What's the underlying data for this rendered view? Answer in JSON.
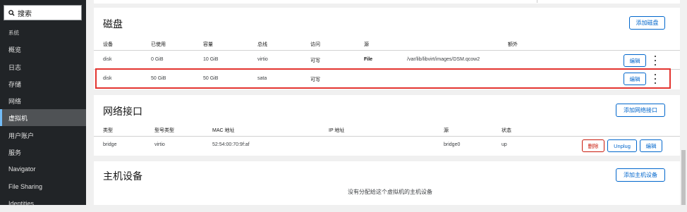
{
  "sidebar": {
    "search_placeholder": "搜索",
    "group_label": "系统",
    "items": [
      {
        "label": "概览"
      },
      {
        "label": "日志"
      },
      {
        "label": "存储"
      },
      {
        "label": "网络"
      },
      {
        "label": "虚拟机"
      },
      {
        "label": "用户账户"
      },
      {
        "label": "服务"
      },
      {
        "label": "Navigator"
      },
      {
        "label": "File Sharing"
      },
      {
        "label": "Identities"
      }
    ],
    "active_item": "虚拟机"
  },
  "disks": {
    "title": "磁盘",
    "add_button": "添加磁盘",
    "columns": [
      "设备",
      "已使用",
      "容量",
      "总线",
      "访问",
      "源",
      "额外"
    ],
    "rows": [
      {
        "device": "disk",
        "used": "0 GiB",
        "capacity": "10 GiB",
        "bus": "virtio",
        "access": "可写",
        "source_type": "File",
        "source_path": "/var/lib/libvirt/images/DSM.qcow2",
        "edit": "编辑"
      },
      {
        "device": "disk",
        "used": "50 GiB",
        "capacity": "50 GiB",
        "bus": "sata",
        "access": "可写",
        "source_type": "",
        "source_path": "",
        "edit": "编辑"
      }
    ]
  },
  "network": {
    "title": "网络接口",
    "add_button": "添加网络接口",
    "columns": [
      "类型",
      "型号类型",
      "MAC 地址",
      "IP 地址",
      "源",
      "状态"
    ],
    "rows": [
      {
        "type": "bridge",
        "model": "virtio",
        "mac": "52:54:00:70:9f:af",
        "ip": "",
        "source": "bridge0",
        "state": "up",
        "delete": "删除",
        "unplug": "Unplug",
        "edit": "编辑"
      }
    ]
  },
  "host_devices": {
    "title": "主机设备",
    "add_button": "添加主机设备",
    "empty_message": "没有分配给这个虚拟机的主机设备"
  },
  "colors": {
    "accent": "#0066cc",
    "danger": "#c9190b",
    "highlight": "#e3342f",
    "sidebar_bg": "#212427"
  }
}
